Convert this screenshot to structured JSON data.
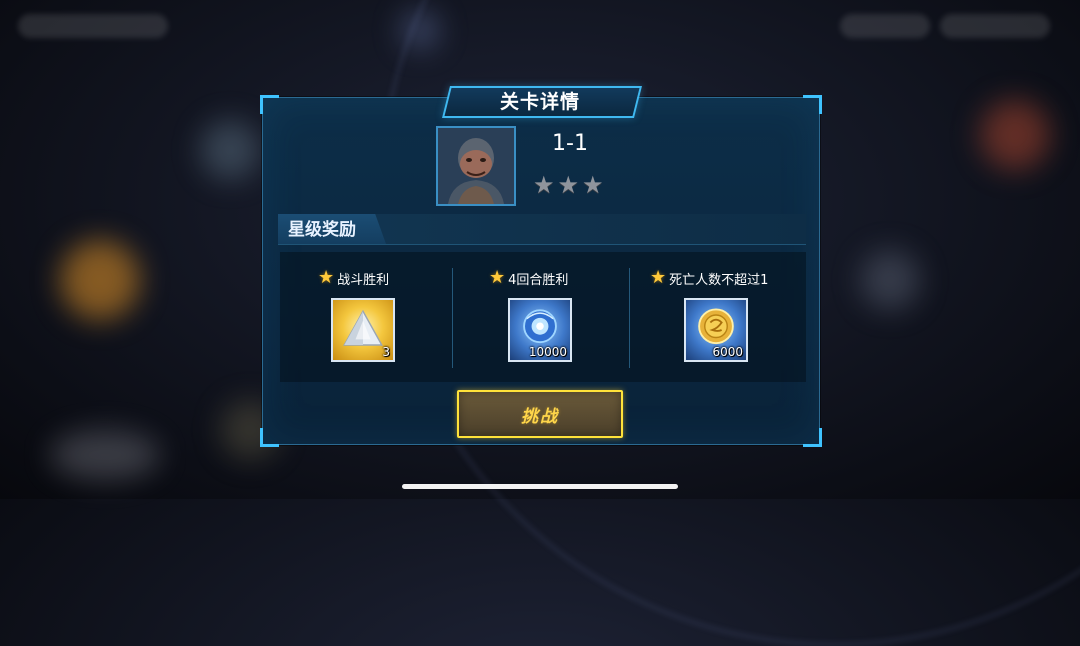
{
  "dialog": {
    "title": "关卡详情",
    "stage": {
      "name": "1-1",
      "stars_earned": 0,
      "stars_total": 3
    },
    "section_title": "星级奖励",
    "rewards": [
      {
        "condition": "战斗胜利",
        "item_icon": "crystal-pyramid-icon",
        "count": "3",
        "color": "#f4c73e"
      },
      {
        "condition": "4回合胜利",
        "item_icon": "blue-energy-orb-icon",
        "count": "10000",
        "color": "#3e78c9"
      },
      {
        "condition": "死亡人数不超过1",
        "item_icon": "gold-coin-icon",
        "count": "6000",
        "color": "#3e78c9"
      }
    ],
    "challenge_label": "挑战"
  },
  "colors": {
    "accent": "#3fc3ff",
    "button_border": "#ffe23a",
    "button_text": "#ffd64a",
    "star_gold": "#ffc93a",
    "star_empty": "#8f949c"
  }
}
